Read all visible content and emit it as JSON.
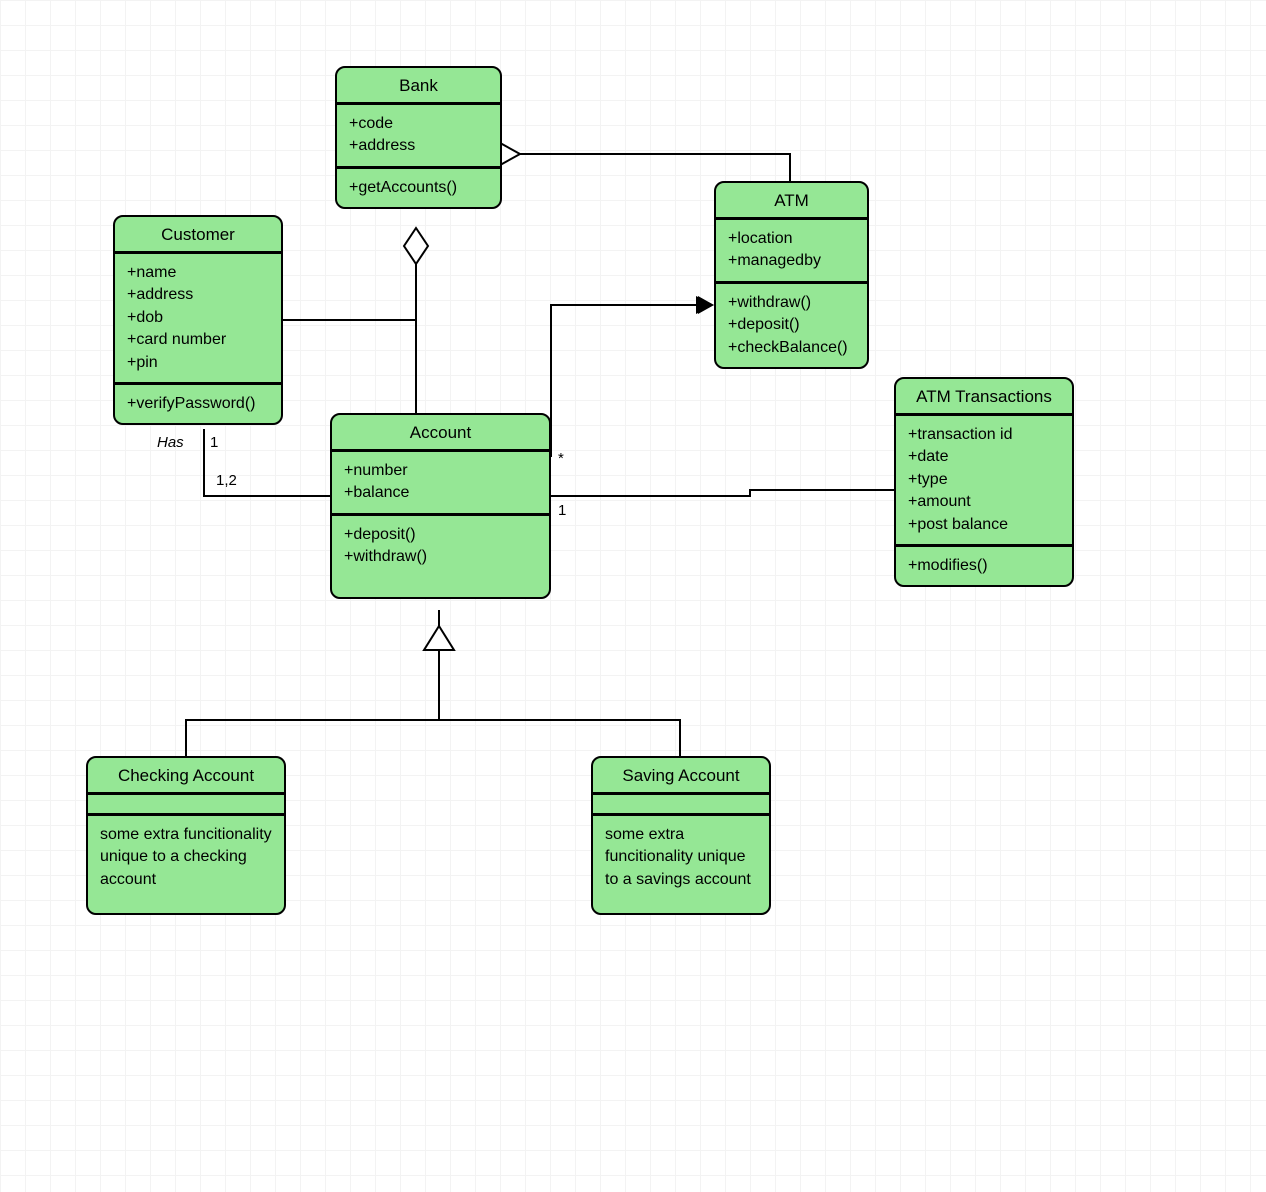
{
  "classes": {
    "bank": {
      "title": "Bank",
      "attrs": "+code\n+address",
      "ops": "+getAccounts()"
    },
    "customer": {
      "title": "Customer",
      "attrs": "+name\n+address\n+dob\n+card number\n+pin",
      "ops": "+verifyPassword()"
    },
    "atm": {
      "title": "ATM",
      "attrs": "+location\n+managedby",
      "ops": "+withdraw()\n+deposit()\n+checkBalance()"
    },
    "account": {
      "title": "Account",
      "attrs": "+number\n+balance",
      "ops": "+deposit()\n+withdraw()"
    },
    "checking": {
      "title": "Checking Account",
      "ops": "some extra funcitionality unique to a checking account"
    },
    "saving": {
      "title": "Saving Account",
      "ops": "some extra funcitionality unique to a savings account"
    },
    "atmtx": {
      "title": "ATM Transactions",
      "attrs": "+transaction id\n+date\n+type\n+amount\n+post balance",
      "ops": "+modifies()"
    }
  },
  "labels": {
    "has": "Has",
    "one": "1",
    "onetwo": "1,2",
    "star": "*",
    "one2": "1"
  },
  "colors": {
    "fill": "#95e795"
  },
  "chart_data": {
    "type": "diagram",
    "diagram_kind": "uml-class",
    "nodes": [
      {
        "id": "Bank",
        "attributes": [
          "+code",
          "+address"
        ],
        "methods": [
          "+getAccounts()"
        ]
      },
      {
        "id": "Customer",
        "attributes": [
          "+name",
          "+address",
          "+dob",
          "+card number",
          "+pin"
        ],
        "methods": [
          "+verifyPassword()"
        ]
      },
      {
        "id": "ATM",
        "attributes": [
          "+location",
          "+managedby"
        ],
        "methods": [
          "+withdraw()",
          "+deposit()",
          "+checkBalance()"
        ]
      },
      {
        "id": "Account",
        "attributes": [
          "+number",
          "+balance"
        ],
        "methods": [
          "+deposit()",
          "+withdraw()"
        ]
      },
      {
        "id": "Checking Account",
        "attributes": [],
        "methods": [
          "some extra funcitionality unique to a checking account"
        ]
      },
      {
        "id": "Saving Account",
        "attributes": [],
        "methods": [
          "some extra funcitionality unique to a savings account"
        ]
      },
      {
        "id": "ATM Transactions",
        "attributes": [
          "+transaction id",
          "+date",
          "+type",
          "+amount",
          "+post balance"
        ],
        "methods": [
          "+modifies()"
        ]
      }
    ],
    "edges": [
      {
        "from": "Bank",
        "to": "ATM",
        "type": "aggregation",
        "diamond_at": "Bank"
      },
      {
        "from": "Bank",
        "to": "Account",
        "type": "aggregation",
        "diamond_at": "Bank"
      },
      {
        "from": "Customer",
        "to": "Account",
        "type": "association",
        "label": "Has",
        "multiplicity": {
          "Customer": "1",
          "Account": "1,2"
        }
      },
      {
        "from": "Account",
        "to": "ATM",
        "type": "association",
        "arrow_to": "ATM",
        "multiplicity": {
          "Account": "*"
        }
      },
      {
        "from": "Account",
        "to": "ATM Transactions",
        "type": "association",
        "multiplicity": {
          "Account": "1"
        }
      },
      {
        "from": "Checking Account",
        "to": "Account",
        "type": "generalization"
      },
      {
        "from": "Saving Account",
        "to": "Account",
        "type": "generalization"
      }
    ]
  }
}
